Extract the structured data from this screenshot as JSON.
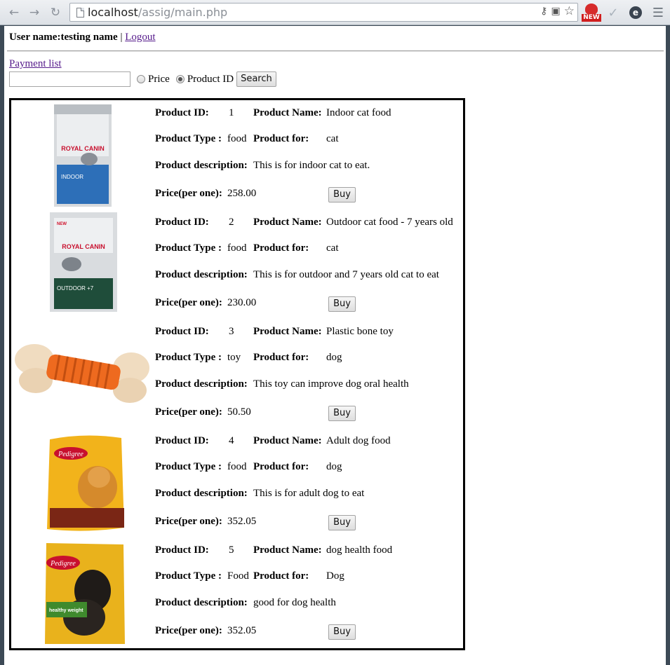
{
  "browser": {
    "url_host": "localhost",
    "url_path": "/assig/main.php",
    "new_badge": "NEW"
  },
  "user": {
    "label": "User name:",
    "name": "testing name",
    "separator": "|",
    "logout": "Logout"
  },
  "nav": {
    "payment_list": "Payment list"
  },
  "search": {
    "value": "",
    "options": [
      "Price",
      "Product ID"
    ],
    "selected": "Product ID",
    "button": "Search"
  },
  "labels": {
    "id": "Product ID:",
    "name": "Product Name:",
    "type": "Product Type :",
    "for": "Product for:",
    "desc": "Product description:",
    "price": "Price(per one):",
    "buy": "Buy"
  },
  "products": [
    {
      "id": "1",
      "name": "Indoor cat food",
      "type": "food",
      "for": "cat",
      "desc": "This is for indoor cat to eat.",
      "price": "258.00",
      "image": "royal-canin-indoor-bag"
    },
    {
      "id": "2",
      "name": "Outdoor cat food - 7 years old",
      "type": "food",
      "for": "cat",
      "desc": "This is for outdoor and 7 years old cat to eat",
      "price": "230.00",
      "image": "royal-canin-outdoor-bag"
    },
    {
      "id": "3",
      "name": "Plastic bone toy",
      "type": "toy",
      "for": "dog",
      "desc": "This toy can improve dog oral health",
      "price": "50.50",
      "image": "plastic-bone-toy"
    },
    {
      "id": "4",
      "name": "Adult dog food",
      "type": "food",
      "for": "dog",
      "desc": "This is for adult dog to eat",
      "price": "352.05",
      "image": "pedigree-adult-bag"
    },
    {
      "id": "5",
      "name": "dog health food",
      "type": "Food",
      "for": "Dog",
      "desc": "good for dog health",
      "price": "352.05",
      "image": "pedigree-healthy-weight-bag"
    }
  ],
  "image_text": {
    "royal_canin": "ROYAL CANIN",
    "indoor": "INDOOR",
    "outdoor": "OUTDOOR +7",
    "new": "NEW",
    "pedigree": "Pedigree",
    "healthy_weight": "healthy weight"
  }
}
